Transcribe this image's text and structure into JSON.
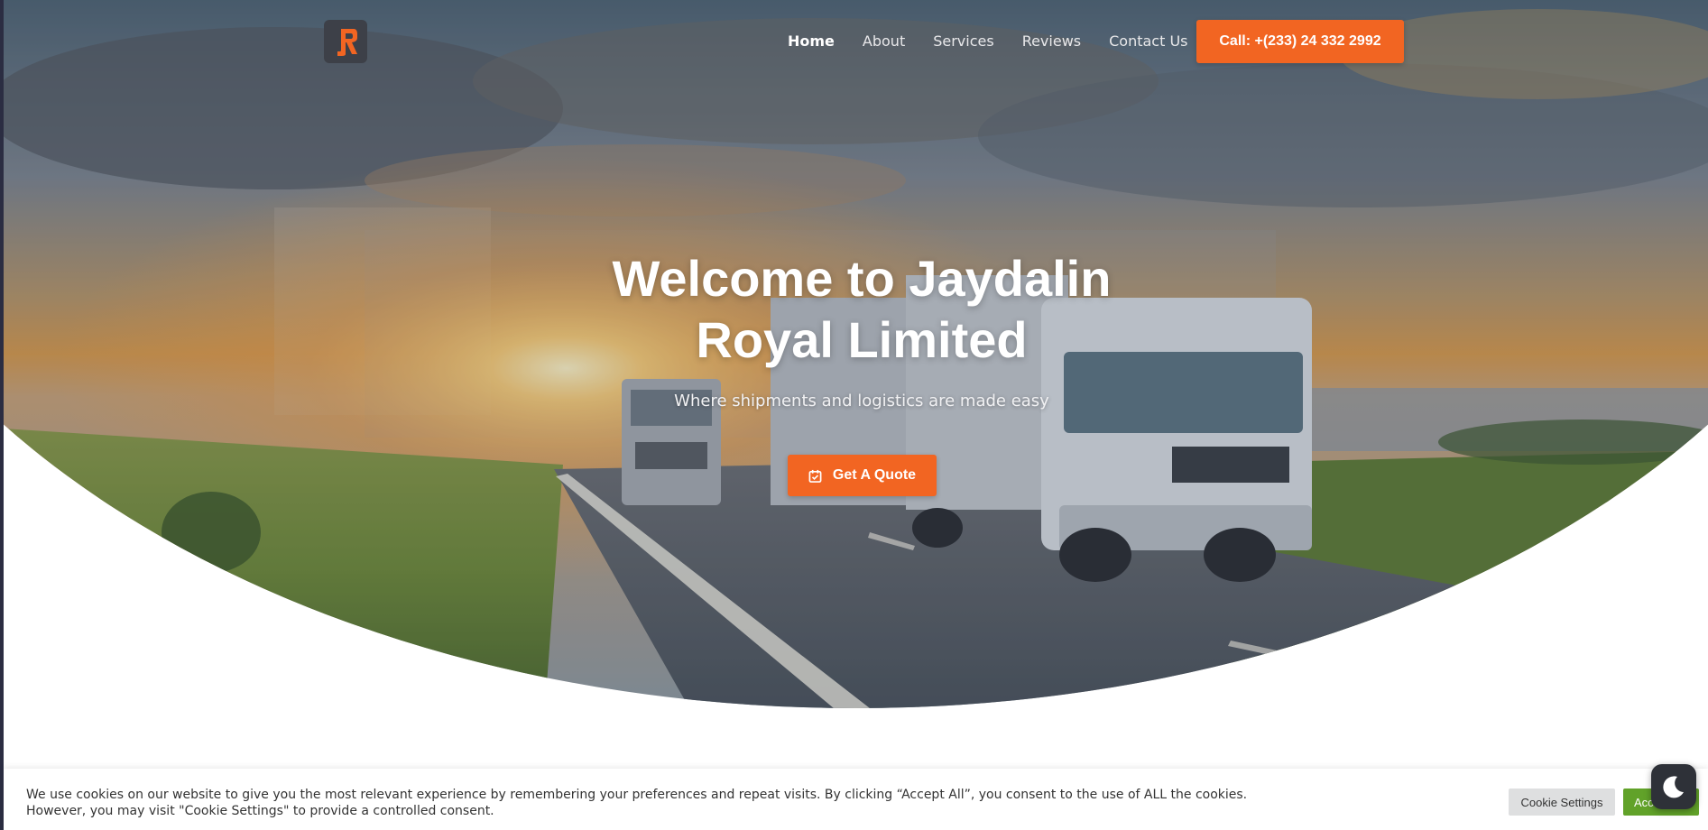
{
  "brand": {
    "logo_icon": "jr-monogram-logo",
    "accent_color": "#f26522"
  },
  "nav": {
    "items": [
      {
        "label": "Home",
        "active": true
      },
      {
        "label": "About",
        "active": false
      },
      {
        "label": "Services",
        "active": false
      },
      {
        "label": "Reviews",
        "active": false
      },
      {
        "label": "Contact Us",
        "active": false
      }
    ],
    "call_button": "Call: +(233) 24 332 2992"
  },
  "hero": {
    "title_line1": "Welcome to Jaydalin",
    "title_line2": "Royal Limited",
    "subtitle": "Where shipments and logistics are made easy",
    "cta_label": "Get A Quote",
    "cta_icon": "calendar-check-icon"
  },
  "cookie": {
    "line1": "We use cookies on our website to give you the most relevant experience by remembering your preferences and repeat visits. By clicking “Accept All”, you consent to the use of ALL the cookies.",
    "line2": "However, you may visit \"Cookie Settings\" to provide a controlled consent.",
    "settings_label": "Cookie Settings",
    "accept_label": "Accept All",
    "accept_color": "#61a229"
  },
  "dark_mode_toggle": {
    "icon": "moon-icon"
  }
}
